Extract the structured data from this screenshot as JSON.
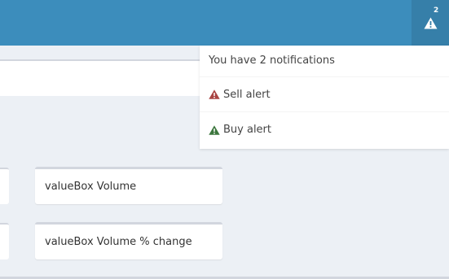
{
  "colors": {
    "navbar": "#3c8dbc",
    "navbar_active": "#367fa9",
    "background": "#ecf0f5",
    "sell_alert_icon": "#a94442",
    "buy_alert_icon": "#3c763d"
  },
  "header": {
    "notifications": {
      "icon": "warning-icon",
      "count": "2"
    }
  },
  "dropdown": {
    "header": "You have 2 notifications",
    "items": [
      {
        "icon": "warning-icon",
        "color": "#a94442",
        "label": "Sell alert"
      },
      {
        "icon": "warning-icon",
        "color": "#3c763d",
        "label": "Buy alert"
      }
    ]
  },
  "main": {
    "value_boxes": [
      {
        "label": "valueBox Volume"
      },
      {
        "label": "valueBox Volume % change"
      }
    ]
  }
}
